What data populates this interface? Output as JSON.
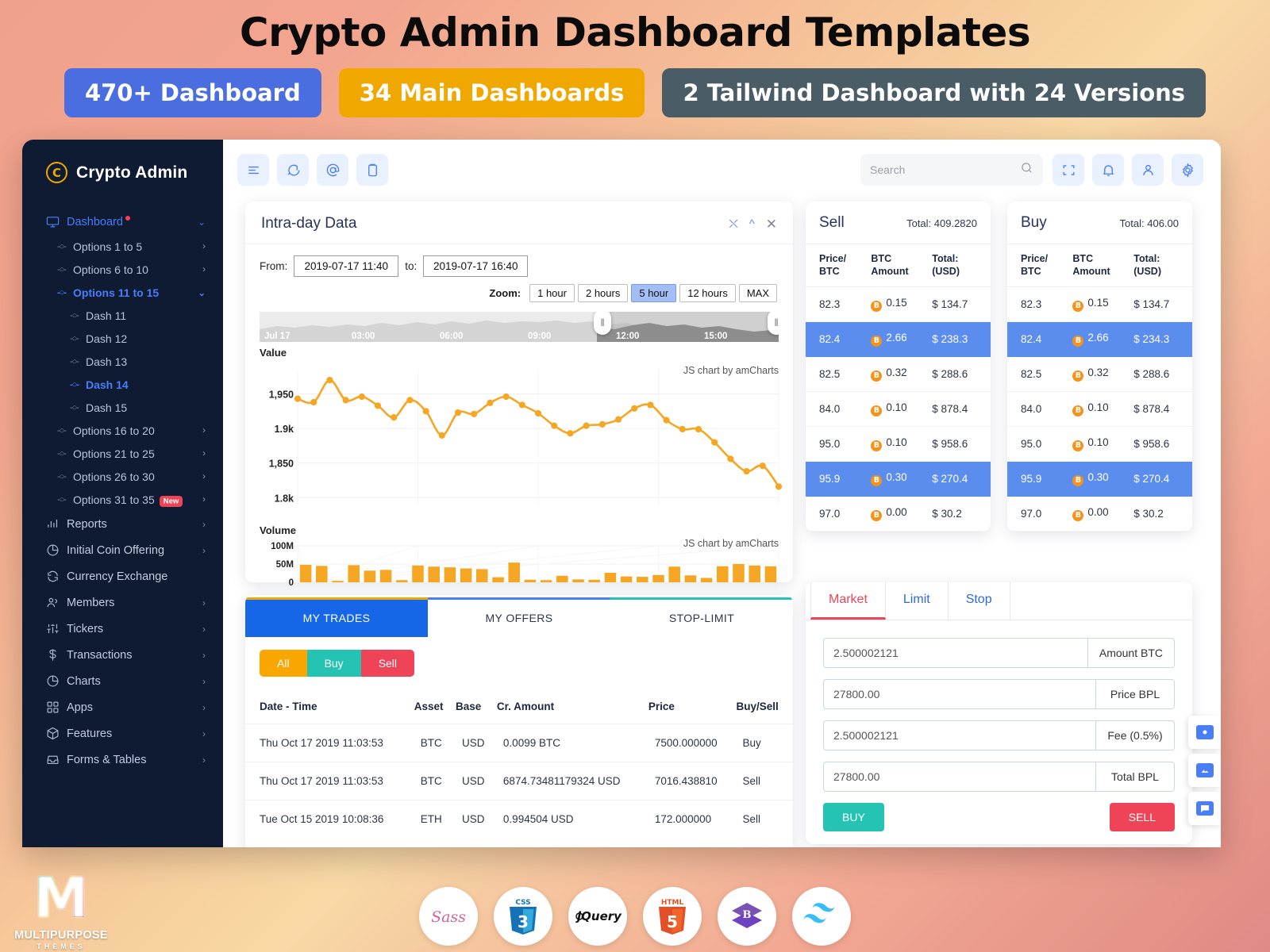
{
  "promo": {
    "title": "Crypto Admin Dashboard Templates",
    "badges": [
      {
        "label": "470+ Dashboard",
        "color": "#4a6ee0"
      },
      {
        "label": "34 Main Dashboards",
        "color": "#f0a800"
      },
      {
        "label": "2 Tailwind Dashboard with 24 Versions",
        "color": "#4a5c66"
      }
    ]
  },
  "sidebar": {
    "brand": "Crypto Admin",
    "brand_initial": "C",
    "dashboard": {
      "label": "Dashboard",
      "has_dot": true,
      "chevron": "⌄"
    },
    "options": [
      {
        "label": "Options 1 to 5",
        "active": false,
        "chevron": "›"
      },
      {
        "label": "Options 6 to 10",
        "active": false,
        "chevron": "›"
      },
      {
        "label": "Options 11 to 15",
        "active": true,
        "chevron": "⌄"
      }
    ],
    "dashes": [
      {
        "label": "Dash 11",
        "active": false
      },
      {
        "label": "Dash 12",
        "active": false
      },
      {
        "label": "Dash 13",
        "active": false
      },
      {
        "label": "Dash 14",
        "active": true
      },
      {
        "label": "Dash 15",
        "active": false
      }
    ],
    "options2": [
      {
        "label": "Options 16 to 20",
        "chevron": "›",
        "tag": ""
      },
      {
        "label": "Options 21 to 25",
        "chevron": "›",
        "tag": ""
      },
      {
        "label": "Options 26 to 30",
        "chevron": "›",
        "tag": ""
      },
      {
        "label": "Options 31 to 35",
        "chevron": "›",
        "tag": "New"
      }
    ],
    "items": [
      {
        "label": "Reports",
        "icon": "bar-chart-icon",
        "chevron": "›"
      },
      {
        "label": "Initial Coin Offering",
        "icon": "pie-chart-icon",
        "chevron": "›"
      },
      {
        "label": "Currency Exchange",
        "icon": "refresh-icon",
        "chevron": ""
      },
      {
        "label": "Members",
        "icon": "users-icon",
        "chevron": "›"
      },
      {
        "label": "Tickers",
        "icon": "sliders-icon",
        "chevron": "›"
      },
      {
        "label": "Transactions",
        "icon": "dollar-icon",
        "chevron": "›"
      },
      {
        "label": "Charts",
        "icon": "pie-chart-icon",
        "chevron": "›"
      },
      {
        "label": "Apps",
        "icon": "grid-icon",
        "chevron": "›"
      },
      {
        "label": "Features",
        "icon": "box-icon",
        "chevron": "›"
      },
      {
        "label": "Forms & Tables",
        "icon": "inbox-icon",
        "chevron": "›"
      }
    ]
  },
  "topbar": {
    "left_icons": [
      "menu-icon",
      "chat-icon",
      "at-icon",
      "clipboard-icon"
    ],
    "search_placeholder": "Search",
    "search_value": "",
    "right_icons": [
      "fullscreen-icon",
      "bell-icon",
      "user-icon",
      "gear-icon"
    ]
  },
  "chart_panel": {
    "title": "Intra-day Data",
    "actions": [
      "expand-icon",
      "collapse-icon",
      "close-icon"
    ],
    "from_label": "From:",
    "from_value": "2019-07-17 11:40",
    "to_label": "to:",
    "to_value": "2019-07-17 16:40",
    "zoom_label": "Zoom:",
    "zoom_options": [
      {
        "label": "1 hour",
        "selected": false
      },
      {
        "label": "2 hours",
        "selected": false
      },
      {
        "label": "5 hour",
        "selected": true
      },
      {
        "label": "12 hours",
        "selected": false
      },
      {
        "label": "MAX",
        "selected": false
      }
    ],
    "watermark": "JS chart by amCharts"
  },
  "chart_data": [
    {
      "type": "line",
      "title": "Value",
      "xlabel": "",
      "ylabel": "Value",
      "ylim": [
        1790,
        1985
      ],
      "yticks": [
        1800,
        1850,
        1900,
        1950
      ],
      "ytick_labels": [
        "1.8k",
        "1,850",
        "1.9k",
        "1,950"
      ],
      "x_tick_labels": [
        "Jul 17",
        "03:00",
        "06:00",
        "09:00",
        "12:00",
        "15:00"
      ],
      "grid": true,
      "color": "#f5a623",
      "values": [
        1943,
        1938,
        1970,
        1941,
        1946,
        1933,
        1916,
        1941,
        1925,
        1890,
        1923,
        1921,
        1937,
        1946,
        1934,
        1922,
        1904,
        1893,
        1904,
        1906,
        1913,
        1929,
        1934,
        1912,
        1899,
        1899,
        1880,
        1856,
        1838,
        1846,
        1816
      ]
    },
    {
      "type": "bar",
      "title": "Volume",
      "ylabel": "Volume",
      "ylim": [
        0,
        100
      ],
      "yticks": [
        0,
        50,
        100
      ],
      "ytick_labels": [
        "0",
        "50M",
        "100M"
      ],
      "color": "#f5a623",
      "values": [
        48,
        45,
        4,
        47,
        32,
        34,
        6,
        46,
        43,
        41,
        38,
        36,
        14,
        54,
        7,
        6,
        18,
        8,
        7,
        26,
        16,
        15,
        20,
        43,
        19,
        12,
        44,
        50,
        46,
        44
      ]
    }
  ],
  "sell_panel": {
    "title": "Sell",
    "total": "Total: 409.2820",
    "columns": [
      "Price/ BTC",
      "BTC Amount",
      "Total: (USD)"
    ],
    "rows": [
      {
        "price": "82.3",
        "amount": "0.15",
        "total": "$ 134.7",
        "highlight": false
      },
      {
        "price": "82.4",
        "amount": "2.66",
        "total": "$ 238.3",
        "highlight": true
      },
      {
        "price": "82.5",
        "amount": "0.32",
        "total": "$ 288.6",
        "highlight": false
      },
      {
        "price": "84.0",
        "amount": "0.10",
        "total": "$ 878.4",
        "highlight": false
      },
      {
        "price": "95.0",
        "amount": "0.10",
        "total": "$ 958.6",
        "highlight": false
      },
      {
        "price": "95.9",
        "amount": "0.30",
        "total": "$ 270.4",
        "highlight": true
      },
      {
        "price": "97.0",
        "amount": "0.00",
        "total": "$ 30.2",
        "highlight": false
      }
    ]
  },
  "buy_panel": {
    "title": "Buy",
    "total": "Total: 406.00",
    "columns": [
      "Price/ BTC",
      "BTC Amount",
      "Total: (USD)"
    ],
    "rows": [
      {
        "price": "82.3",
        "amount": "0.15",
        "total": "$ 134.7",
        "highlight": false
      },
      {
        "price": "82.4",
        "amount": "2.66",
        "total": "$ 234.3",
        "highlight": true
      },
      {
        "price": "82.5",
        "amount": "0.32",
        "total": "$ 288.6",
        "highlight": false
      },
      {
        "price": "84.0",
        "amount": "0.10",
        "total": "$ 878.4",
        "highlight": false
      },
      {
        "price": "95.0",
        "amount": "0.10",
        "total": "$ 958.6",
        "highlight": false
      },
      {
        "price": "95.9",
        "amount": "0.30",
        "total": "$ 270.4",
        "highlight": true
      },
      {
        "price": "97.0",
        "amount": "0.00",
        "total": "$ 30.2",
        "highlight": false
      }
    ]
  },
  "order_form": {
    "tabs": [
      {
        "label": "Market",
        "active": true
      },
      {
        "label": "Limit",
        "active": false
      },
      {
        "label": "Stop",
        "active": false
      }
    ],
    "fields": [
      {
        "value": "2.500002121",
        "suffix": "Amount BTC"
      },
      {
        "value": "27800.00",
        "suffix": "Price BPL"
      },
      {
        "value": "2.500002121",
        "suffix": "Fee (0.5%)"
      },
      {
        "value": "27800.00",
        "suffix": "Total BPL"
      }
    ],
    "buy_label": "BUY",
    "sell_label": "SELL"
  },
  "trades_panel": {
    "tabs": [
      {
        "label": "MY TRADES",
        "active": true
      },
      {
        "label": "MY OFFERS",
        "active": false
      },
      {
        "label": "STOP-LIMIT",
        "active": false
      }
    ],
    "filters": [
      {
        "label": "All",
        "color": "#f9a700"
      },
      {
        "label": "Buy",
        "color": "#25c3b4"
      },
      {
        "label": "Sell",
        "color": "#ef4458"
      }
    ],
    "columns": [
      "Date - Time",
      "Asset",
      "Base",
      "Cr. Amount",
      "Price",
      "Buy/Sell"
    ],
    "rows": [
      {
        "date": "Thu Oct 17 2019 11:03:53",
        "asset": "BTC",
        "base": "USD",
        "amount": "0.0099 BTC",
        "price": "7500.000000",
        "side": "Buy"
      },
      {
        "date": "Thu Oct 17 2019 11:03:53",
        "asset": "BTC",
        "base": "USD",
        "amount": "6874.73481179324 USD",
        "price": "7016.438810",
        "side": "Sell"
      },
      {
        "date": "Tue Oct 15 2019 10:08:36",
        "asset": "ETH",
        "base": "USD",
        "amount": "0.994504 USD",
        "price": "172.000000",
        "side": "Sell"
      }
    ]
  },
  "side_fabs": [
    "camera-icon",
    "image-icon",
    "comment-icon"
  ],
  "footer": {
    "logos": [
      "sass-logo",
      "css3-logo",
      "jquery-logo",
      "html5-logo",
      "bootstrap-logo",
      "tailwind-logo"
    ],
    "brand_mark": "M",
    "brand_line1": "MULTIPURPOSE",
    "brand_line2": "THEMES"
  }
}
